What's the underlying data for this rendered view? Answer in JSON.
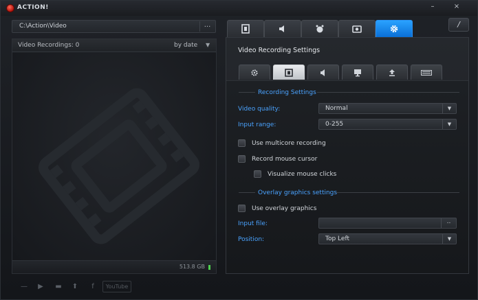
{
  "app": {
    "title": "ACTION!"
  },
  "window_controls": {
    "minimize": "–",
    "close": "×"
  },
  "path_bar": {
    "path": "C:\\Action\\Video",
    "browse_label": "..."
  },
  "recordings": {
    "count_label": "Video Recordings: 0",
    "sort_label": "by date",
    "disk_free": "513.8 GB"
  },
  "bottom_toolbar": {
    "youtube_label": "YouTube"
  },
  "main_tabs": [
    {
      "icon": "film-icon"
    },
    {
      "icon": "speaker-icon"
    },
    {
      "icon": "gamepad-icon"
    },
    {
      "icon": "camera-icon"
    },
    {
      "icon": "gear-icon",
      "active": true
    }
  ],
  "help_button": {
    "label": "/"
  },
  "settings": {
    "title": "Video Recording Settings",
    "sub_tabs": [
      {
        "icon": "gear-icon"
      },
      {
        "icon": "film-icon",
        "active": true
      },
      {
        "icon": "speaker-icon"
      },
      {
        "icon": "monitor-icon"
      },
      {
        "icon": "upload-icon"
      },
      {
        "icon": "keyboard-icon"
      }
    ],
    "recording_group": "Recording Settings",
    "video_quality": {
      "label": "Video quality:",
      "value": "Normal"
    },
    "input_range": {
      "label": "Input range:",
      "value": "0-255"
    },
    "multicore": {
      "label": "Use multicore recording",
      "checked": false
    },
    "mouse_cursor": {
      "label": "Record mouse cursor",
      "checked": false
    },
    "mouse_clicks": {
      "label": "Visualize mouse clicks",
      "checked": false
    },
    "overlay_group": "Overlay graphics settings",
    "use_overlay": {
      "label": "Use overlay graphics",
      "checked": false
    },
    "input_file": {
      "label": "Input file:",
      "value": "",
      "browse_label": ".."
    },
    "position": {
      "label": "Position:",
      "value": "Top Left"
    }
  },
  "colors": {
    "accent": "#1a8cf0",
    "label_blue": "#4aa3ff",
    "disk_led": "#4fd14f"
  }
}
